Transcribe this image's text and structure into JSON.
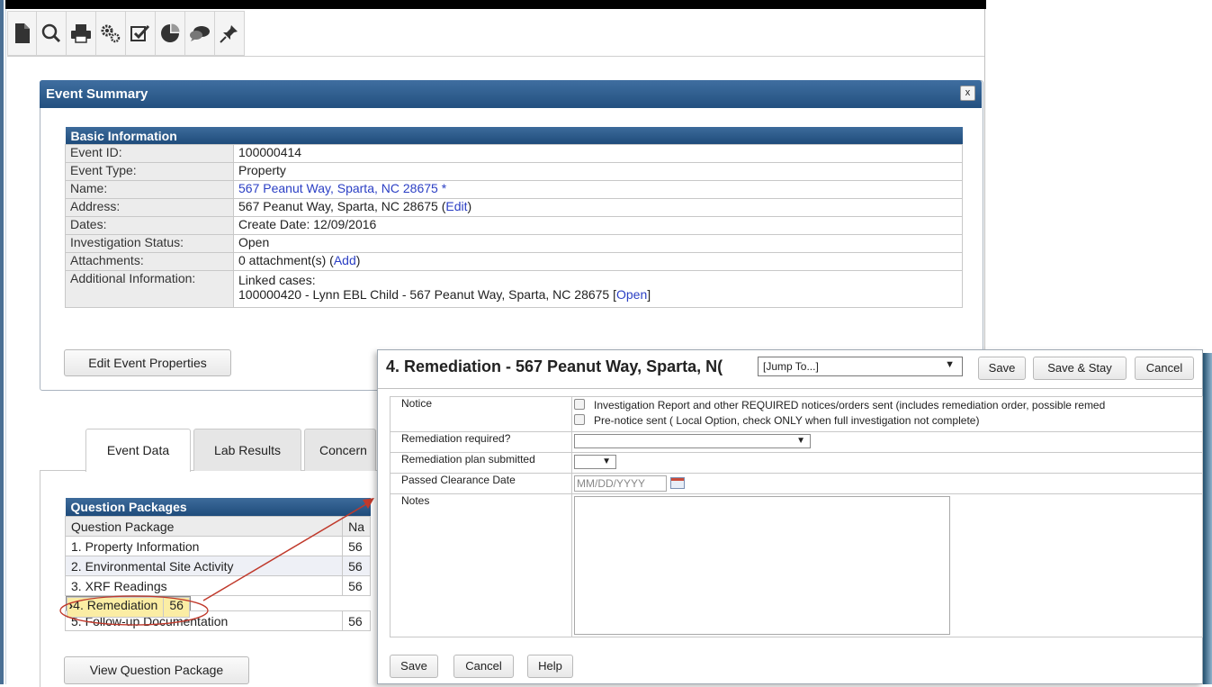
{
  "toolbar": {
    "icons": [
      "new-document-icon",
      "search-icon",
      "print-icon",
      "settings-gears-icon",
      "checkbox-icon",
      "pie-chart-icon",
      "chat-bubbles-icon",
      "pin-icon"
    ]
  },
  "event_summary": {
    "title": "Event Summary",
    "close_label": "x",
    "basic_info": {
      "title": "Basic Information",
      "rows": [
        {
          "label": "Event ID:",
          "value": "100000414"
        },
        {
          "label": "Event Type:",
          "value": "Property"
        },
        {
          "label": "Name:",
          "value": "567 Peanut Way, Sparta, NC 28675 *"
        },
        {
          "label": "Address:",
          "value": "567 Peanut Way, Sparta, NC 28675 (",
          "link": "Edit",
          "suffix": ")"
        },
        {
          "label": "Dates:",
          "value": "Create Date: 12/09/2016"
        },
        {
          "label": "Investigation Status:",
          "value": "Open"
        },
        {
          "label": "Attachments:",
          "value": "0 attachment(s) (",
          "link": "Add",
          "suffix": ")"
        },
        {
          "label": "Additional Information:",
          "value": "Linked cases:",
          "value2": "100000420 - Lynn EBL Child - 567 Peanut Way, Sparta, NC 28675 [",
          "link": "Open",
          "suffix": "]"
        }
      ]
    },
    "edit_button": "Edit Event Properties"
  },
  "tabs": [
    {
      "label": "Event Data",
      "active": true
    },
    {
      "label": "Lab Results",
      "active": false
    },
    {
      "label": "Concern",
      "active": false
    }
  ],
  "question_packages": {
    "title": "Question Packages",
    "col1": "Question Package",
    "col2": "Na",
    "rows": [
      {
        "name": "1. Property Information",
        "c2": "56"
      },
      {
        "name": "2. Environmental Site Activity",
        "c2": "56"
      },
      {
        "name": "3. XRF Readings",
        "c2": "56"
      },
      {
        "name": "4. Remediation",
        "c2": "56",
        "selected": true
      },
      {
        "name": "5. Follow-up Documentation",
        "c2": "56"
      }
    ],
    "selected_marker": "›",
    "view_button": "View Question Package"
  },
  "remediation": {
    "title": "4. Remediation - 567 Peanut Way, Sparta, N(",
    "jump_select": "[Jump To...]",
    "save": "Save",
    "save_stay": "Save & Stay",
    "cancel": "Cancel",
    "help": "Help",
    "fields": {
      "notice_label": "Notice",
      "notice_opt1": "Investigation Report and other REQUIRED notices/orders sent (includes remediation order, possible remed",
      "notice_opt2": "Pre-notice sent ( Local Option, check ONLY when full investigation not complete)",
      "remediation_required_label": "Remediation required?",
      "remediation_required_value": "",
      "plan_submitted_label": "Remediation plan submitted",
      "plan_submitted_value": "",
      "clearance_label": "Passed Clearance Date",
      "clearance_placeholder": "MM/DD/YYYY",
      "notes_label": "Notes",
      "notes_value": ""
    }
  },
  "colors": {
    "header_blue": "#23507f",
    "link_blue": "#2b3fc4",
    "selected_row": "#fbeda4",
    "annotation_red": "#c0392b"
  }
}
